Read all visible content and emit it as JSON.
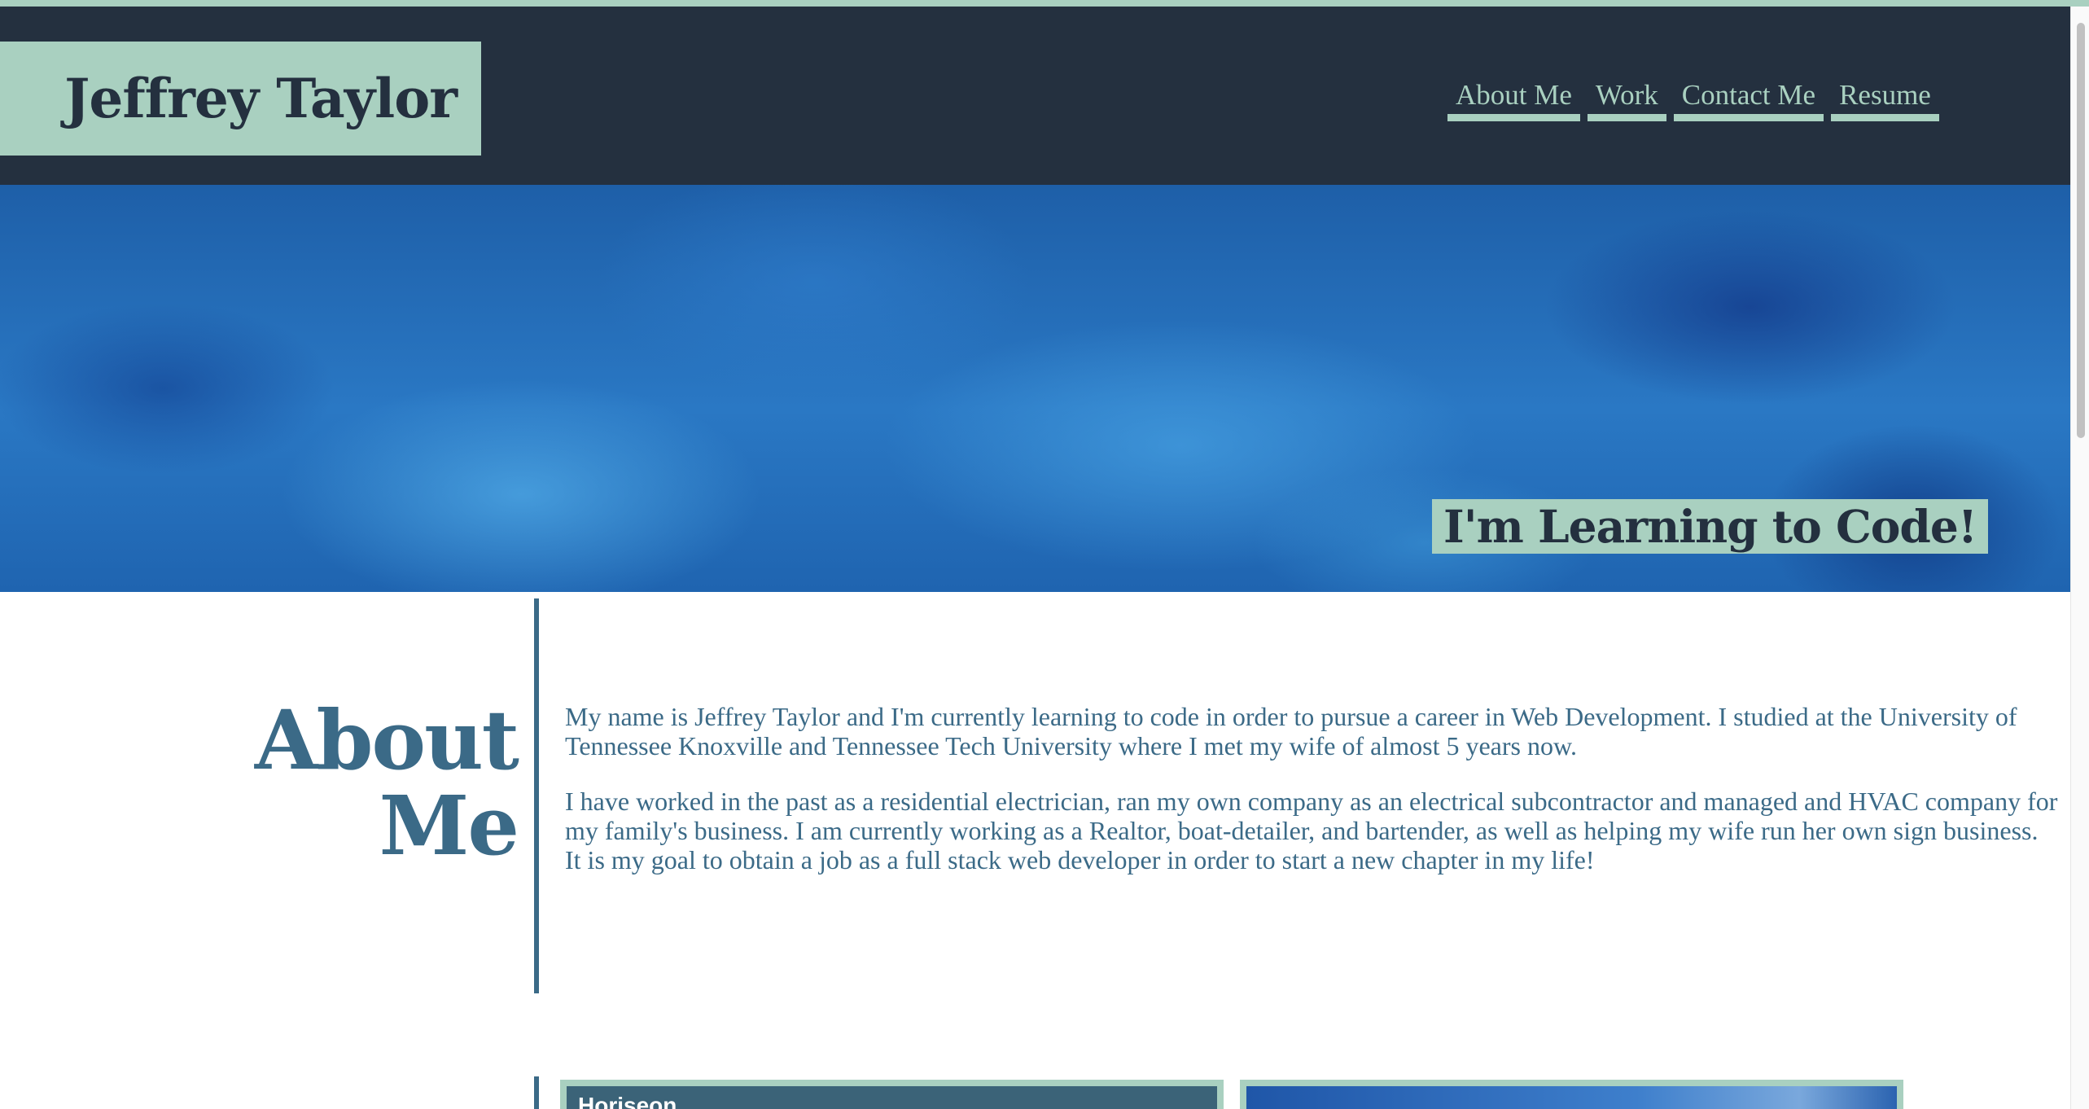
{
  "header": {
    "title": "Jeffrey Taylor",
    "nav": [
      "About Me",
      "Work",
      "Contact Me",
      "Resume"
    ]
  },
  "hero": {
    "tagline": "I'm Learning to Code!"
  },
  "about": {
    "heading_line1": "About",
    "heading_line2": "Me",
    "paragraphs": [
      "My name is Jeffrey Taylor and I'm currently learning to code in order to pursue a career in Web Development. I studied at the University of Tennessee Knoxville and Tennessee Tech University where I met my wife of almost 5 years now.",
      "I have worked in the past as a residential electrician, ran my own company as an electrical subcontractor and managed and HVAC company for my family's business. I am currently working as a Realtor, boat-detailer, and bartender, as well as helping my wife run her own sign business. It is my goal to obtain a job as a full stack web developer in order to start a new chapter in my life!"
    ]
  },
  "work": {
    "card1_title": "Horiseon"
  },
  "colors": {
    "header_bg": "#24303f",
    "accent": "#a9d0c0",
    "text_blue": "#3b6a87"
  }
}
